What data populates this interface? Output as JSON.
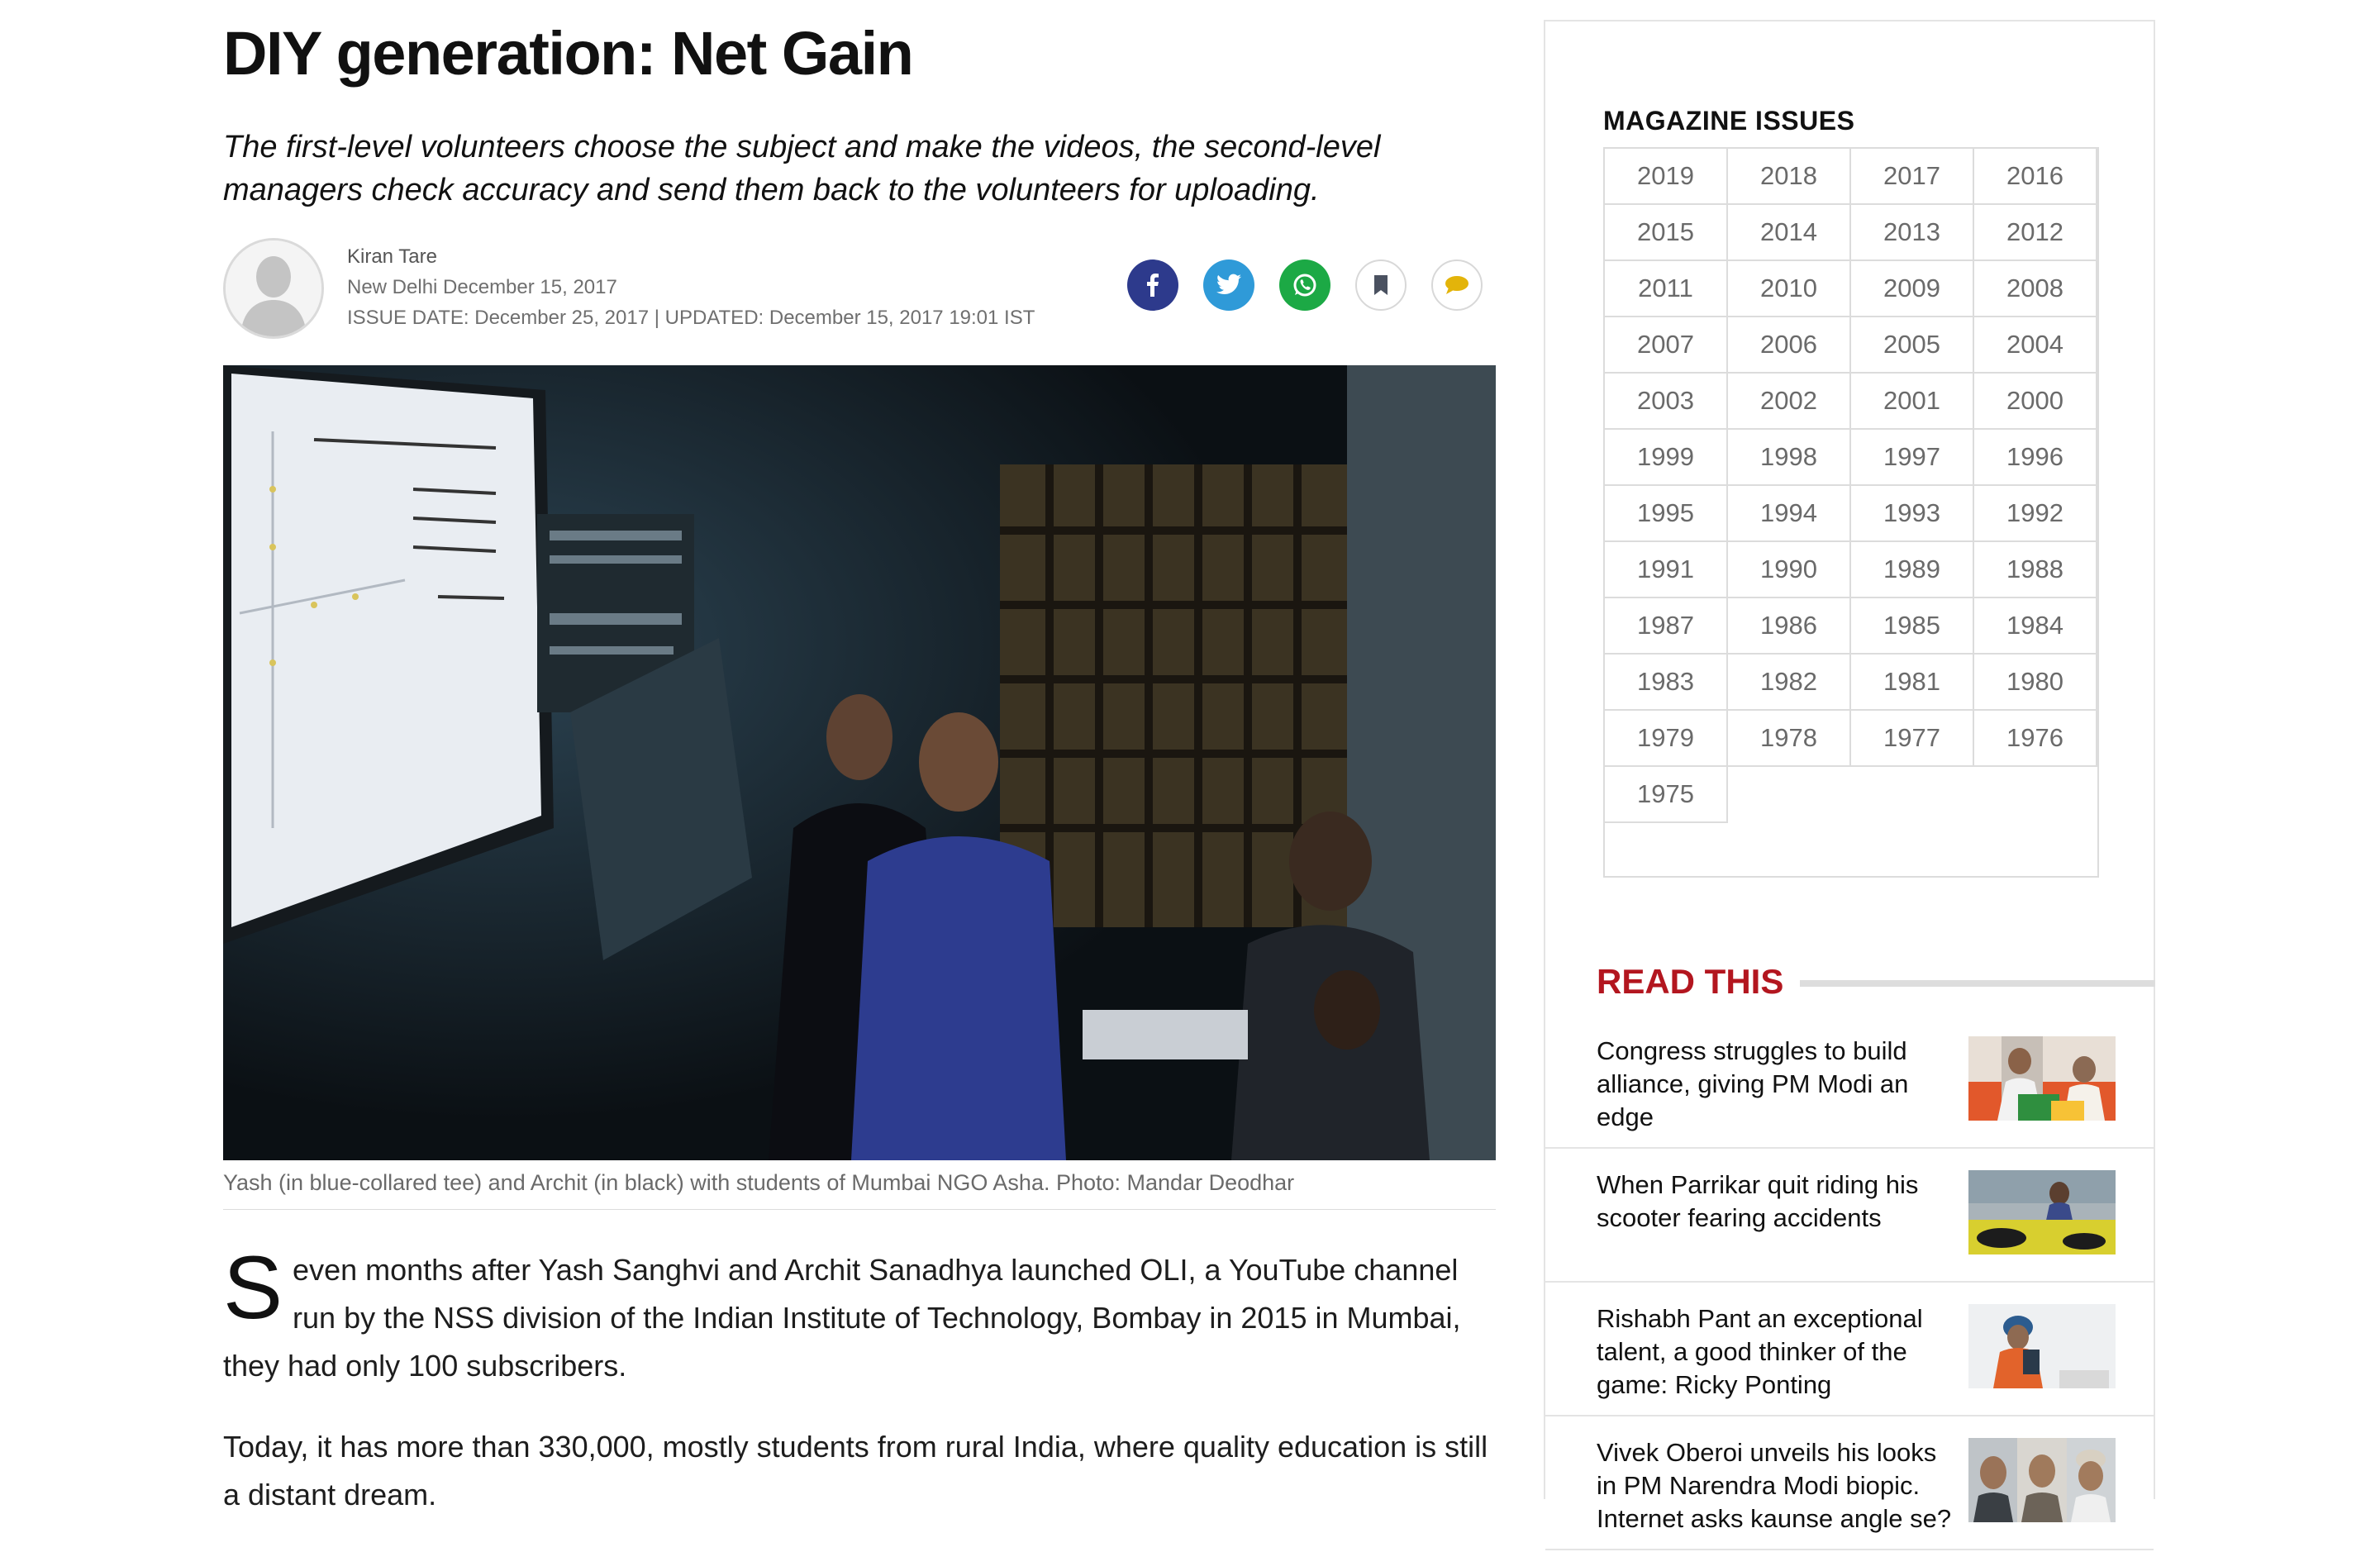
{
  "article": {
    "title": "DIY generation: Net Gain",
    "kicker": "The first-level volunteers choose the subject and make the videos, the second-level managers check accuracy and send them back to the volunteers for uploading.",
    "author": "Kiran Tare",
    "dateline": "New Delhi December 15, 2017",
    "issue_line": "ISSUE DATE: December 25, 2017 | UPDATED: December 15, 2017 19:01 IST",
    "caption": "Yash (in blue-collared tee) and Archit (in black) with students of Mumbai NGO Asha. Photo: Mandar Deodhar",
    "dropcap": "S",
    "para1": "even months after Yash Sanghvi and Archit Sanadhya launched OLI, a YouTube channel run by the NSS division of the Indian Institute of Technology, Bombay in 2015 in Mumbai, they had only 100 subscribers.",
    "para2": "Today, it has more than 330,000, mostly students from rural India, where quality education is still a distant dream."
  },
  "share": {
    "icons": [
      "facebook-icon",
      "twitter-icon",
      "whatsapp-icon",
      "bookmark-icon",
      "comment-icon"
    ],
    "colors": {
      "facebook": "#2d3a8c",
      "twitter": "#2f9ad8",
      "whatsapp": "#1ca945",
      "comment": "#e3b40a"
    }
  },
  "sidebar": {
    "magazine_heading": "MAGAZINE ISSUES",
    "years": [
      "2019",
      "2018",
      "2017",
      "2016",
      "2015",
      "2014",
      "2013",
      "2012",
      "2011",
      "2010",
      "2009",
      "2008",
      "2007",
      "2006",
      "2005",
      "2004",
      "2003",
      "2002",
      "2001",
      "2000",
      "1999",
      "1998",
      "1997",
      "1996",
      "1995",
      "1994",
      "1993",
      "1992",
      "1991",
      "1990",
      "1989",
      "1988",
      "1987",
      "1986",
      "1985",
      "1984",
      "1983",
      "1982",
      "1981",
      "1980",
      "1979",
      "1978",
      "1977",
      "1976",
      "1975"
    ],
    "read_this_heading": "READ THIS",
    "read_this_color": "#b3161f",
    "read_items": [
      {
        "title": "Congress struggles to build alliance, giving PM Modi an edge"
      },
      {
        "title": "When Parrikar quit riding his scooter fearing accidents"
      },
      {
        "title": "Rishabh Pant an exceptional talent, a good thinker of the game: Ricky Ponting"
      },
      {
        "title": "Vivek Oberoi unveils his looks in PM Narendra Modi biopic. Internet asks kaunse angle se?"
      }
    ]
  }
}
